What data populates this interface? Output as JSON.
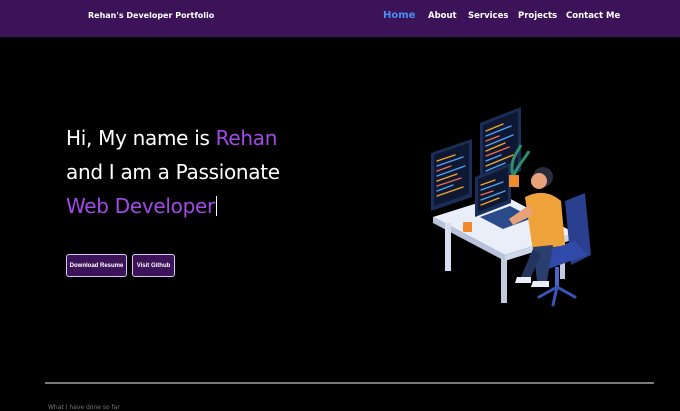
{
  "navbar": {
    "brand": "Rehan's Developer Portfolio",
    "links": [
      {
        "label": "Home",
        "active": true
      },
      {
        "label": "About",
        "active": false
      },
      {
        "label": "Services",
        "active": false
      },
      {
        "label": "Projects",
        "active": false
      },
      {
        "label": "Contact Me",
        "active": false
      }
    ]
  },
  "hero": {
    "line1_prefix": "Hi, My name is ",
    "line1_name": "Rehan",
    "line2": "and I am a Passionate",
    "line3_typed": "Web Developer"
  },
  "buttons": {
    "resume": "Download Resume",
    "github": "Visit Github"
  },
  "next_section": {
    "peek_text": "What I have done so far"
  },
  "colors": {
    "navbar_bg": "#3c1359",
    "accent_purple": "#a14ae6",
    "active_link": "#4a8ef5",
    "background": "#000000"
  }
}
